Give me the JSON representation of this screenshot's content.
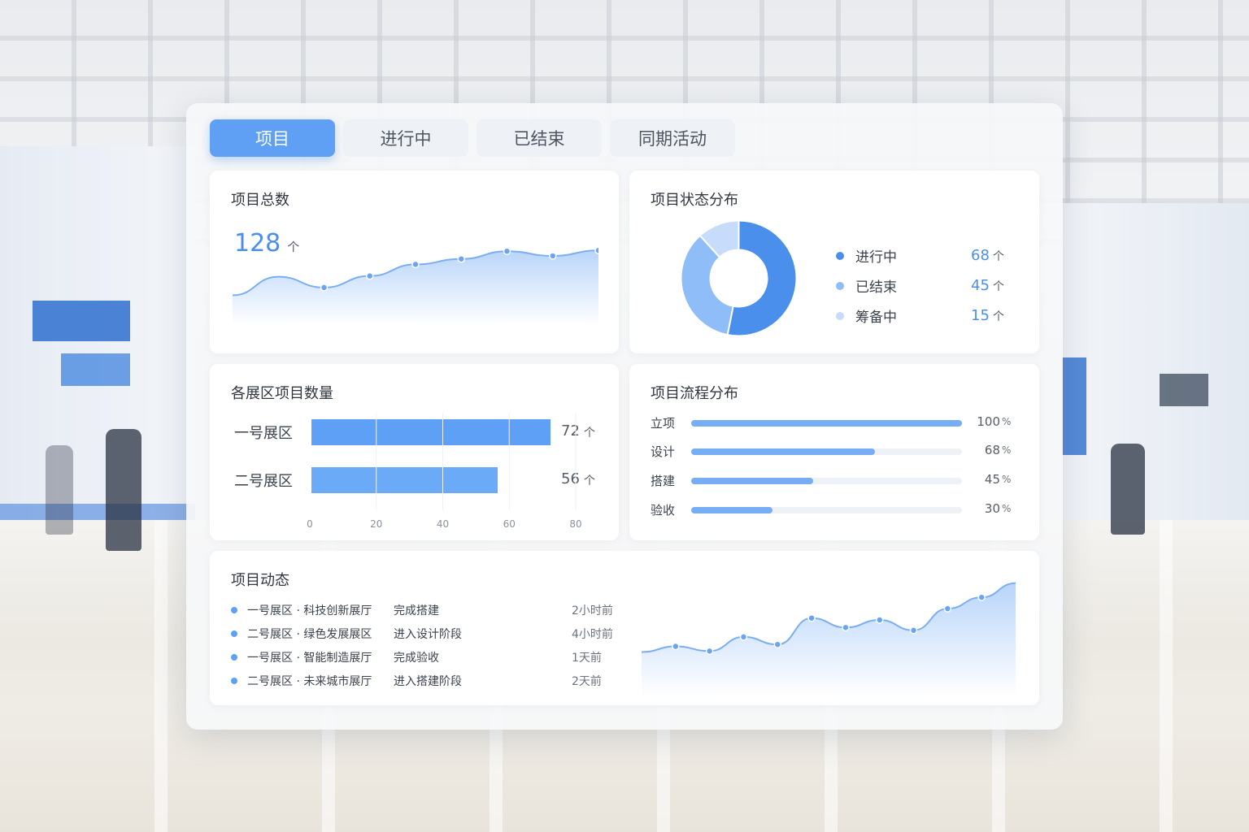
{
  "tabs": [
    {
      "label": "项目",
      "active": true
    },
    {
      "label": "进行中",
      "active": false
    },
    {
      "label": "已结束",
      "active": false
    },
    {
      "label": "同期活动",
      "active": false
    }
  ],
  "total": {
    "title": "项目总数",
    "value": "128",
    "unit": "个",
    "trend": [
      28,
      52,
      38,
      53,
      68,
      75,
      85,
      79,
      86
    ]
  },
  "status": {
    "title": "项目状态分布",
    "items": [
      {
        "label": "进行中",
        "value": 68,
        "value_text": "68",
        "unit": "个",
        "color": "#4b8fec"
      },
      {
        "label": "已结束",
        "value": 45,
        "value_text": "45",
        "unit": "个",
        "color": "#8fbdf7"
      },
      {
        "label": "筹备中",
        "value": 15,
        "value_text": "15",
        "unit": "个",
        "color": "#c7dcfa"
      }
    ]
  },
  "zones": {
    "title": "各展区项目数量",
    "items": [
      {
        "label": "一号展区",
        "value": 72,
        "value_text": "72",
        "unit": "个"
      },
      {
        "label": "二号展区",
        "value": 56,
        "value_text": "56",
        "unit": "个"
      }
    ],
    "axis_ticks": [
      "0",
      "20",
      "40",
      "60",
      "80"
    ],
    "axis_max": 80
  },
  "flow": {
    "title": "项目流程分布",
    "items": [
      {
        "label": "立项",
        "value": 100,
        "value_text": "100",
        "unit": "%"
      },
      {
        "label": "设计",
        "value": 68,
        "value_text": "68",
        "unit": "%"
      },
      {
        "label": "搭建",
        "value": 45,
        "value_text": "45",
        "unit": "%"
      },
      {
        "label": "验收",
        "value": 30,
        "value_text": "30",
        "unit": "%"
      }
    ]
  },
  "feed": {
    "title": "项目动态",
    "items": [
      {
        "zone": "一号展区 · 科技创新展厅",
        "action": "完成搭建",
        "time": "2小时前"
      },
      {
        "zone": "二号展区 · 绿色发展展区",
        "action": "进入设计阶段",
        "time": "4小时前"
      },
      {
        "zone": "一号展区 · 智能制造展厅",
        "action": "完成验收",
        "time": "1天前"
      },
      {
        "zone": "二号展区 · 未来城市展厅",
        "action": "进入搭建阶段",
        "time": "2天前"
      }
    ],
    "trend": [
      22,
      28,
      23,
      38,
      30,
      58,
      48,
      56,
      45,
      68,
      80,
      95
    ]
  },
  "colors": {
    "accent": "#4b8fec",
    "accent_light": "#8fbdf7",
    "accent_pale": "#c7dcfa"
  }
}
